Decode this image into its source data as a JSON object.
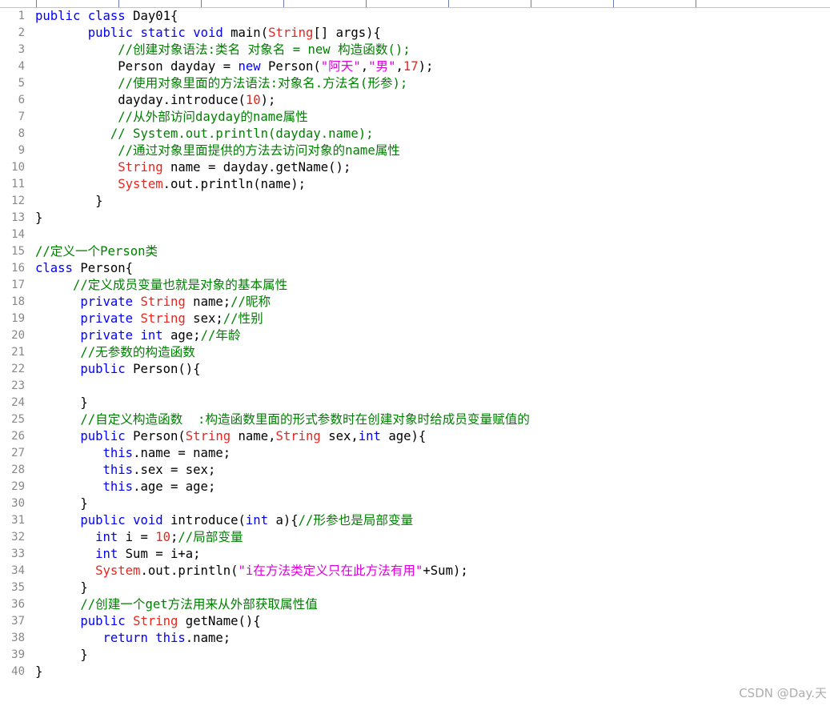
{
  "editor": {
    "watermark": "CSDN @Day.天",
    "colors": {
      "keyword": "#0000ff",
      "type": "#e8251e",
      "comment": "#008000",
      "string": "#e000e0",
      "number": "#e8251e",
      "plain": "#000000",
      "line_number": "#888888"
    },
    "ruler_marks": [
      "1",
      "2",
      "3",
      "4",
      "5",
      "6",
      "7",
      "8",
      "9"
    ],
    "lines": [
      [
        [
          "kw",
          "public"
        ],
        [
          "p",
          " "
        ],
        [
          "kw",
          "class"
        ],
        [
          "p",
          " Day01{"
        ]
      ],
      [
        [
          "p",
          "       "
        ],
        [
          "kw",
          "public"
        ],
        [
          "p",
          " "
        ],
        [
          "kw",
          "static"
        ],
        [
          "p",
          " "
        ],
        [
          "kw",
          "void"
        ],
        [
          "p",
          " main("
        ],
        [
          "ty",
          "String"
        ],
        [
          "p",
          "[] args){"
        ]
      ],
      [
        [
          "p",
          "           "
        ],
        [
          "cm",
          "//创建对象语法:类名 对象名 = new 构造函数();"
        ]
      ],
      [
        [
          "p",
          "           Person dayday = "
        ],
        [
          "kw",
          "new"
        ],
        [
          "p",
          " Person("
        ],
        [
          "st",
          "\"阿天\""
        ],
        [
          "p",
          ","
        ],
        [
          "st",
          "\"男\""
        ],
        [
          "p",
          ","
        ],
        [
          "nu",
          "17"
        ],
        [
          "p",
          ");"
        ]
      ],
      [
        [
          "p",
          "           "
        ],
        [
          "cm",
          "//使用对象里面的方法语法:对象名.方法名(形参);"
        ]
      ],
      [
        [
          "p",
          "           dayday.introduce("
        ],
        [
          "nu",
          "10"
        ],
        [
          "p",
          ");"
        ]
      ],
      [
        [
          "p",
          "           "
        ],
        [
          "cm",
          "//从外部访问dayday的name属性"
        ]
      ],
      [
        [
          "p",
          "          "
        ],
        [
          "cm",
          "// System.out.println(dayday.name);"
        ]
      ],
      [
        [
          "p",
          "           "
        ],
        [
          "cm",
          "//通过对象里面提供的方法去访问对象的name属性"
        ]
      ],
      [
        [
          "p",
          "           "
        ],
        [
          "ty",
          "String"
        ],
        [
          "p",
          " name = dayday.getName();"
        ]
      ],
      [
        [
          "p",
          "           "
        ],
        [
          "ty",
          "System"
        ],
        [
          "p",
          ".out.println(name);"
        ]
      ],
      [
        [
          "p",
          "        }"
        ]
      ],
      [
        [
          "p",
          "}"
        ]
      ],
      [],
      [
        [
          "cm",
          "//定义一个Person类"
        ]
      ],
      [
        [
          "kw",
          "class"
        ],
        [
          "p",
          " Person{"
        ]
      ],
      [
        [
          "p",
          "     "
        ],
        [
          "cm",
          "//定义成员变量也就是对象的基本属性"
        ]
      ],
      [
        [
          "p",
          "      "
        ],
        [
          "kw",
          "private"
        ],
        [
          "p",
          " "
        ],
        [
          "ty",
          "String"
        ],
        [
          "p",
          " name;"
        ],
        [
          "cm",
          "//昵称"
        ]
      ],
      [
        [
          "p",
          "      "
        ],
        [
          "kw",
          "private"
        ],
        [
          "p",
          " "
        ],
        [
          "ty",
          "String"
        ],
        [
          "p",
          " sex;"
        ],
        [
          "cm",
          "//性别"
        ]
      ],
      [
        [
          "p",
          "      "
        ],
        [
          "kw",
          "private"
        ],
        [
          "p",
          " "
        ],
        [
          "kw",
          "int"
        ],
        [
          "p",
          " age;"
        ],
        [
          "cm",
          "//年龄"
        ]
      ],
      [
        [
          "p",
          "      "
        ],
        [
          "cm",
          "//无参数的构造函数"
        ]
      ],
      [
        [
          "p",
          "      "
        ],
        [
          "kw",
          "public"
        ],
        [
          "p",
          " Person(){"
        ]
      ],
      [],
      [
        [
          "p",
          "      }"
        ]
      ],
      [
        [
          "p",
          "      "
        ],
        [
          "cm",
          "//自定义构造函数  :构造函数里面的形式参数时在创建对象时给成员变量赋值的"
        ]
      ],
      [
        [
          "p",
          "      "
        ],
        [
          "kw",
          "public"
        ],
        [
          "p",
          " Person("
        ],
        [
          "ty",
          "String"
        ],
        [
          "p",
          " name,"
        ],
        [
          "ty",
          "String"
        ],
        [
          "p",
          " sex,"
        ],
        [
          "kw",
          "int"
        ],
        [
          "p",
          " age){"
        ]
      ],
      [
        [
          "p",
          "         "
        ],
        [
          "kw",
          "this"
        ],
        [
          "p",
          ".name = name;"
        ]
      ],
      [
        [
          "p",
          "         "
        ],
        [
          "kw",
          "this"
        ],
        [
          "p",
          ".sex = sex;"
        ]
      ],
      [
        [
          "p",
          "         "
        ],
        [
          "kw",
          "this"
        ],
        [
          "p",
          ".age = age;"
        ]
      ],
      [
        [
          "p",
          "      }"
        ]
      ],
      [
        [
          "p",
          "      "
        ],
        [
          "kw",
          "public"
        ],
        [
          "p",
          " "
        ],
        [
          "kw",
          "void"
        ],
        [
          "p",
          " introduce("
        ],
        [
          "kw",
          "int"
        ],
        [
          "p",
          " a){"
        ],
        [
          "cm",
          "//形参也是局部变量"
        ]
      ],
      [
        [
          "p",
          "        "
        ],
        [
          "kw",
          "int"
        ],
        [
          "p",
          " i = "
        ],
        [
          "nu",
          "10"
        ],
        [
          "p",
          ";"
        ],
        [
          "cm",
          "//局部变量"
        ]
      ],
      [
        [
          "p",
          "        "
        ],
        [
          "kw",
          "int"
        ],
        [
          "p",
          " Sum = i+a;"
        ]
      ],
      [
        [
          "p",
          "        "
        ],
        [
          "ty",
          "System"
        ],
        [
          "p",
          ".out.println("
        ],
        [
          "st",
          "\"i在方法类定义只在此方法有用\""
        ],
        [
          "p",
          "+Sum);"
        ]
      ],
      [
        [
          "p",
          "      }"
        ]
      ],
      [
        [
          "p",
          "      "
        ],
        [
          "cm",
          "//创建一个get方法用来从外部获取属性值"
        ]
      ],
      [
        [
          "p",
          "      "
        ],
        [
          "kw",
          "public"
        ],
        [
          "p",
          " "
        ],
        [
          "ty",
          "String"
        ],
        [
          "p",
          " getName(){"
        ]
      ],
      [
        [
          "p",
          "         "
        ],
        [
          "kw",
          "return"
        ],
        [
          "p",
          " "
        ],
        [
          "kw",
          "this"
        ],
        [
          "p",
          ".name;"
        ]
      ],
      [
        [
          "p",
          "      }"
        ]
      ],
      [
        [
          "p",
          "}"
        ]
      ]
    ]
  }
}
